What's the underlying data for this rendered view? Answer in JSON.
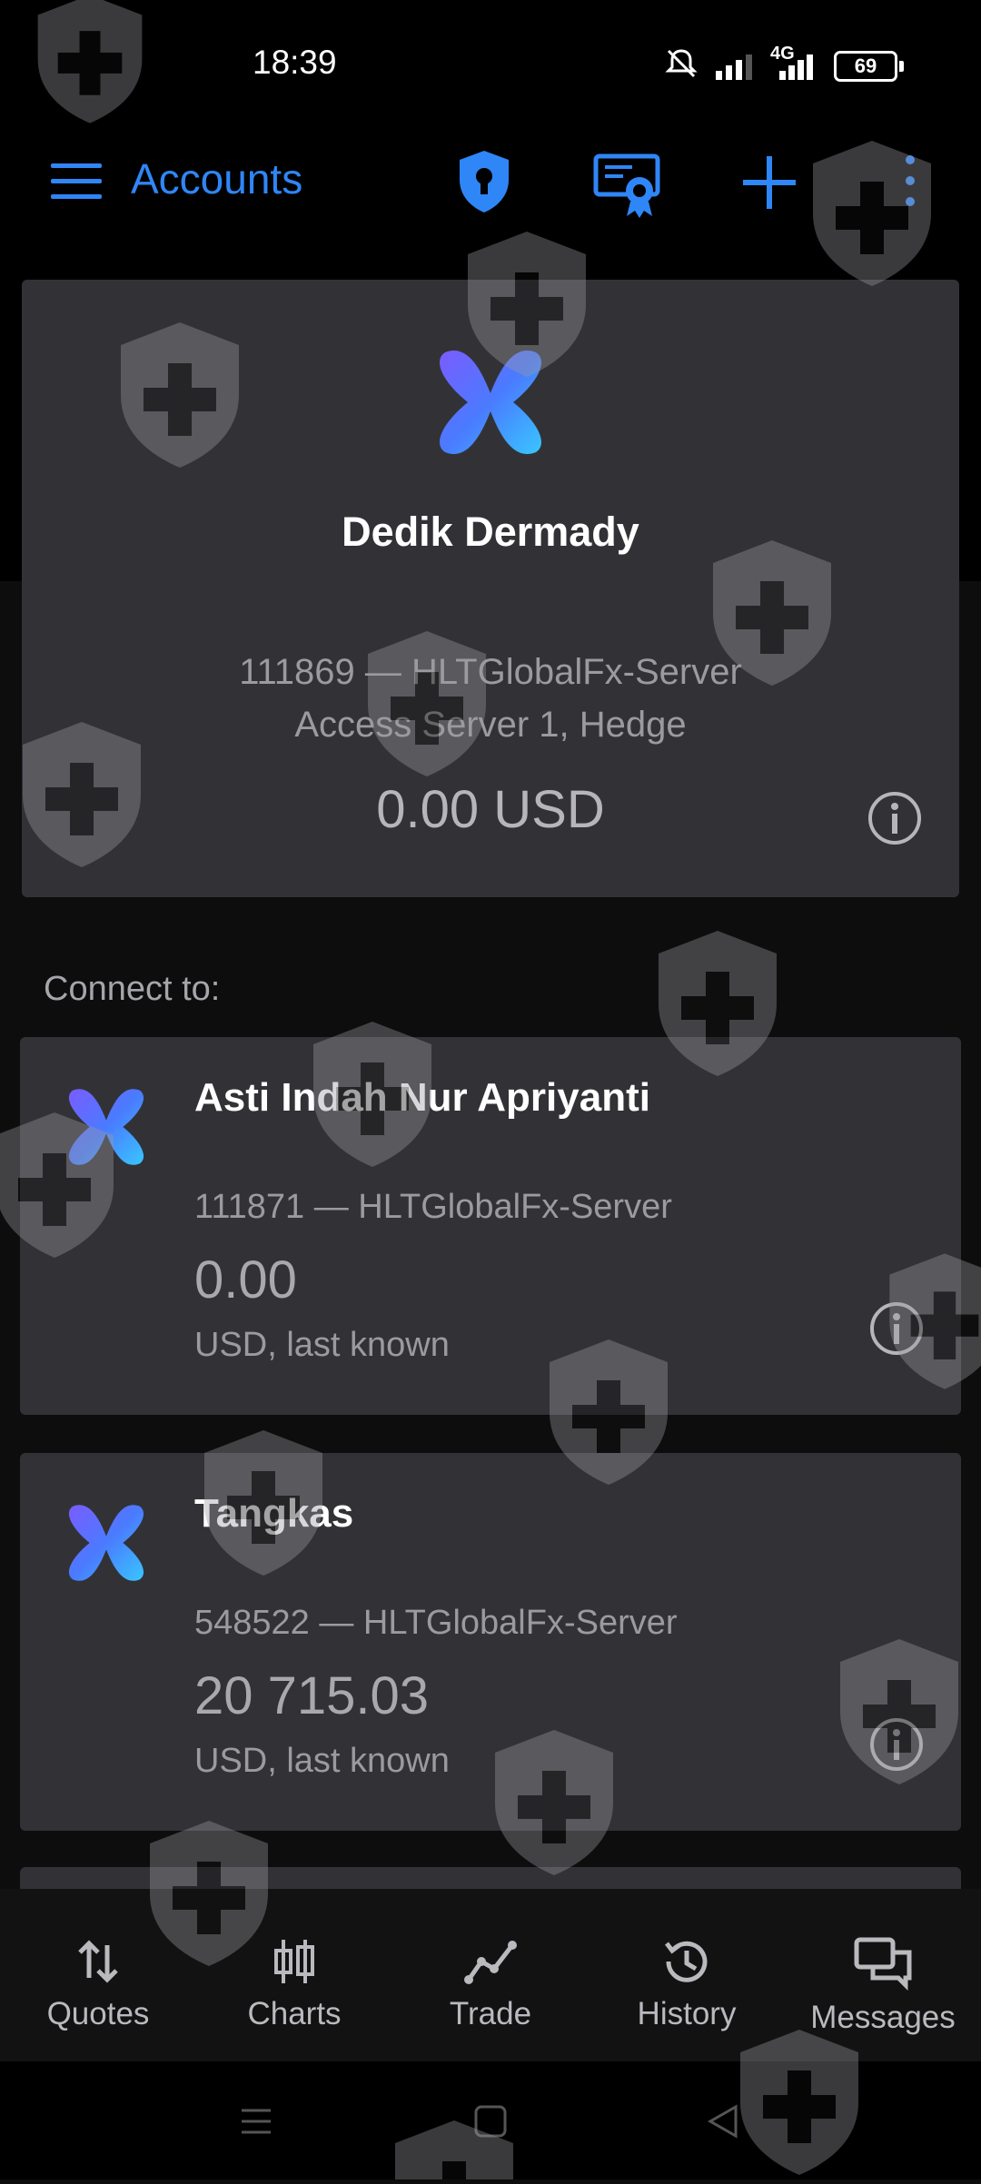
{
  "status_bar": {
    "time": "18:39",
    "network": "4G",
    "battery": "69"
  },
  "app_bar": {
    "title": "Accounts"
  },
  "active_account": {
    "name": "Dedik Dermady",
    "line1": "111869 — HLTGlobalFx-Server",
    "line2": "Access Server 1, Hedge",
    "balance": "0.00 USD"
  },
  "connect_label": "Connect to:",
  "accounts": [
    {
      "name": "Asti Indah Nur Apriyanti",
      "line": "111871 — HLTGlobalFx-Server",
      "balance": "0.00",
      "note": "USD, last known"
    },
    {
      "name": "Tangkas",
      "line": "548522 — HLTGlobalFx-Server",
      "balance": "20 715.03",
      "note": "USD, last known"
    }
  ],
  "bottom_nav": [
    {
      "label": "Quotes",
      "icon": "arrows-updown-icon"
    },
    {
      "label": "Charts",
      "icon": "candles-icon"
    },
    {
      "label": "Trade",
      "icon": "trend-line-icon"
    },
    {
      "label": "History",
      "icon": "history-clock-icon"
    },
    {
      "label": "Messages",
      "icon": "chat-bubbles-icon"
    }
  ],
  "colors": {
    "accent": "#2f86f6",
    "card": "#323236",
    "background": "#0d0d0e"
  }
}
